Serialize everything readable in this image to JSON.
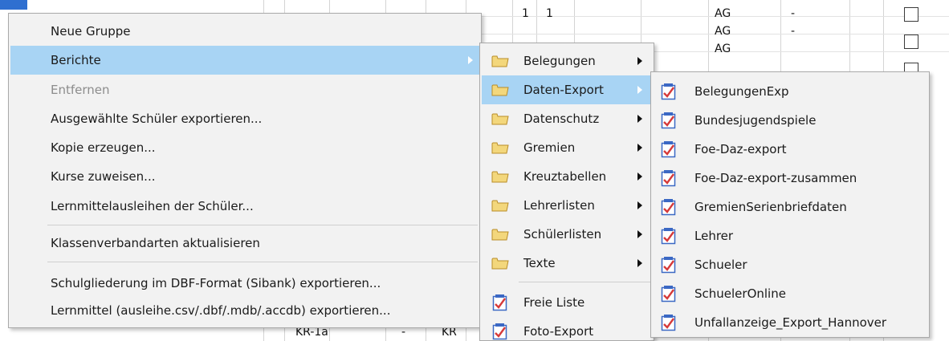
{
  "background": {
    "rows": [
      {
        "c1": "1",
        "c2": "1",
        "c3": "AG",
        "c4": "-"
      },
      {
        "c1": "",
        "c2": "",
        "c3": "AG",
        "c4": "-"
      },
      {
        "c1": "",
        "c2": "",
        "c3": "AG",
        "c4": ""
      }
    ],
    "bottom_row": {
      "a": "KR-1a",
      "b": "-",
      "c": "KR"
    }
  },
  "main_menu": {
    "items": [
      {
        "label": "Neue Gruppe"
      },
      {
        "label": "Berichte"
      },
      {
        "label": "Entfernen"
      },
      {
        "label": "Ausgewählte Schüler exportieren..."
      },
      {
        "label": "Kopie erzeugen..."
      },
      {
        "label": "Kurse zuweisen..."
      },
      {
        "label": "Lernmittelausleihen der Schüler..."
      },
      {
        "label": "Klassenverbandarten aktualisieren"
      },
      {
        "label": "Schulgliederung im DBF-Format (Sibank) exportieren..."
      },
      {
        "label": "Lernmittel (ausleihe.csv/.dbf/.mdb/.accdb) exportieren..."
      }
    ]
  },
  "berichte_menu": {
    "items": [
      {
        "label": "Belegungen"
      },
      {
        "label": "Daten-Export"
      },
      {
        "label": "Datenschutz"
      },
      {
        "label": "Gremien"
      },
      {
        "label": "Kreuztabellen"
      },
      {
        "label": "Lehrerlisten"
      },
      {
        "label": "Schülerlisten"
      },
      {
        "label": "Texte"
      },
      {
        "label": "Freie Liste"
      },
      {
        "label": "Foto-Export"
      }
    ]
  },
  "export_menu": {
    "items": [
      {
        "label": "BelegungenExp"
      },
      {
        "label": "Bundesjugendspiele"
      },
      {
        "label": "Foe-Daz-export"
      },
      {
        "label": "Foe-Daz-export-zusammen"
      },
      {
        "label": "GremienSerienbriefdaten"
      },
      {
        "label": "Lehrer"
      },
      {
        "label": "Schueler"
      },
      {
        "label": "SchuelerOnline"
      },
      {
        "label": "Unfallanzeige_Export_Hannover"
      }
    ]
  },
  "icons": {
    "folder": "folder-icon",
    "report": "report-document-icon",
    "submenu": "submenu-arrow-icon"
  },
  "colors": {
    "highlight": "#a8d4f4",
    "menu_bg": "#f2f2f2",
    "disabled_text": "#8c8c8c",
    "folder_fill": "#f3d77c",
    "report_red": "#d63a3a",
    "report_blue": "#3b68c4"
  }
}
